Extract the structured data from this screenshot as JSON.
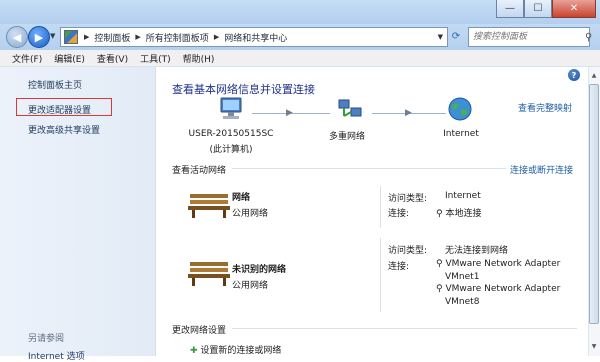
{
  "titlebar": {
    "minimize": "—",
    "maximize": "☐",
    "close": "✕"
  },
  "address": {
    "crumbs": [
      "控制面板",
      "所有控制面板项",
      "网络和共享中心"
    ],
    "search_placeholder": "搜索控制面板"
  },
  "menu": [
    "文件(F)",
    "编辑(E)",
    "查看(V)",
    "工具(T)",
    "帮助(H)"
  ],
  "sidebar": {
    "links": [
      "控制面板主页",
      "更改适配器设置",
      "更改高级共享设置"
    ],
    "see_also_title": "另请参阅",
    "see_also_item": "Internet 选项"
  },
  "main": {
    "heading": "查看基本网络信息并设置连接",
    "view_full_map": "查看完整映射",
    "nodes": [
      {
        "label": "USER-20150515SC",
        "sub": "(此计算机)"
      },
      {
        "label": "多重网络",
        "sub": ""
      },
      {
        "label": "Internet",
        "sub": ""
      }
    ],
    "active_networks_title": "查看活动网络",
    "connect_disconnect": "连接或断开连接",
    "networks": [
      {
        "name": "网络",
        "type": "公用网络",
        "access_label": "访问类型:",
        "access_value": "Internet",
        "conn_label": "连接:",
        "connections": [
          "本地连接"
        ]
      },
      {
        "name": "未识别的网络",
        "type": "公用网络",
        "access_label": "访问类型:",
        "access_value": "无法连接到网络",
        "conn_label": "连接:",
        "connections": [
          "VMware Network Adapter",
          "VMnet1",
          "VMware Network Adapter",
          "VMnet8"
        ]
      }
    ],
    "change_settings_title": "更改网络设置",
    "setup_new": "设置新的连接或网络"
  },
  "colors": {
    "link": "#1f5fa6",
    "highlight": "#d63a3a",
    "heading": "#1e3287"
  }
}
